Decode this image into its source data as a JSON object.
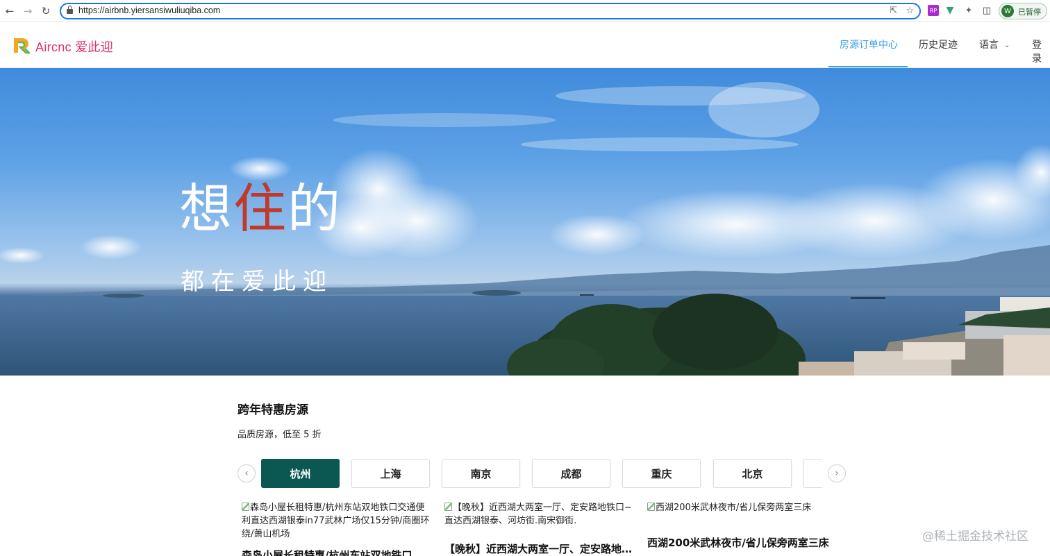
{
  "browser": {
    "url": "https://airbnb.yiersansiwuliuqiba.com",
    "profile_initial": "W",
    "profile_status": "已暂停",
    "extensions": [
      {
        "name": "rp-extension-icon",
        "label": "RP"
      },
      {
        "name": "vue-devtools-icon"
      },
      {
        "name": "extensions-puzzle-icon"
      },
      {
        "name": "side-panel-icon"
      }
    ]
  },
  "header": {
    "logo_text": "Aircnc 爱此迎",
    "nav": [
      {
        "label": "房源订单中心",
        "active": true
      },
      {
        "label": "历史足迹",
        "active": false
      },
      {
        "label": "语言",
        "active": false,
        "has_dropdown": true
      },
      {
        "label": "登录",
        "active": false
      }
    ],
    "accent_color": "#3b9ee8",
    "brand_color": "#e0316a"
  },
  "hero": {
    "title_part1": "想",
    "title_accent": "住",
    "title_part2": "的",
    "subtitle": "都在爱此迎",
    "accent_color": "#c0392b"
  },
  "deals": {
    "title": "跨年特惠房源",
    "subtitle": "品质房源，低至 5 折",
    "cities": [
      {
        "label": "杭州",
        "active": true
      },
      {
        "label": "上海",
        "active": false
      },
      {
        "label": "南京",
        "active": false
      },
      {
        "label": "成都",
        "active": false
      },
      {
        "label": "重庆",
        "active": false
      },
      {
        "label": "北京",
        "active": false
      },
      {
        "label": "",
        "active": false
      }
    ],
    "active_color": "#0b5752",
    "listings": [
      {
        "img_alt": "森岛小屋长租特惠/杭州东站双地铁口交通便利直达西湖银泰in77武林广场仅15分钟/商圈环绕/萧山机场",
        "title": "森岛小屋长租特惠/杭州东站双地铁口交通便利直达西湖银泰in77武林广场仅15分钟/商圈环绕/萧山机场"
      },
      {
        "img_alt": "【晚秋】近西湖大两室一厅、定安路地铁口~直达西湖银泰、河坊街.南宋御街.",
        "title": "【晚秋】近西湖大两室一厅、定安路地铁口~直达西湖银泰、河坊街.南宋御街."
      },
      {
        "img_alt": "西湖200米武林夜市/省儿保旁两室三床",
        "title": "西湖200米武林夜市/省儿保旁两室三床"
      }
    ]
  },
  "watermark": "@稀土掘金技术社区"
}
